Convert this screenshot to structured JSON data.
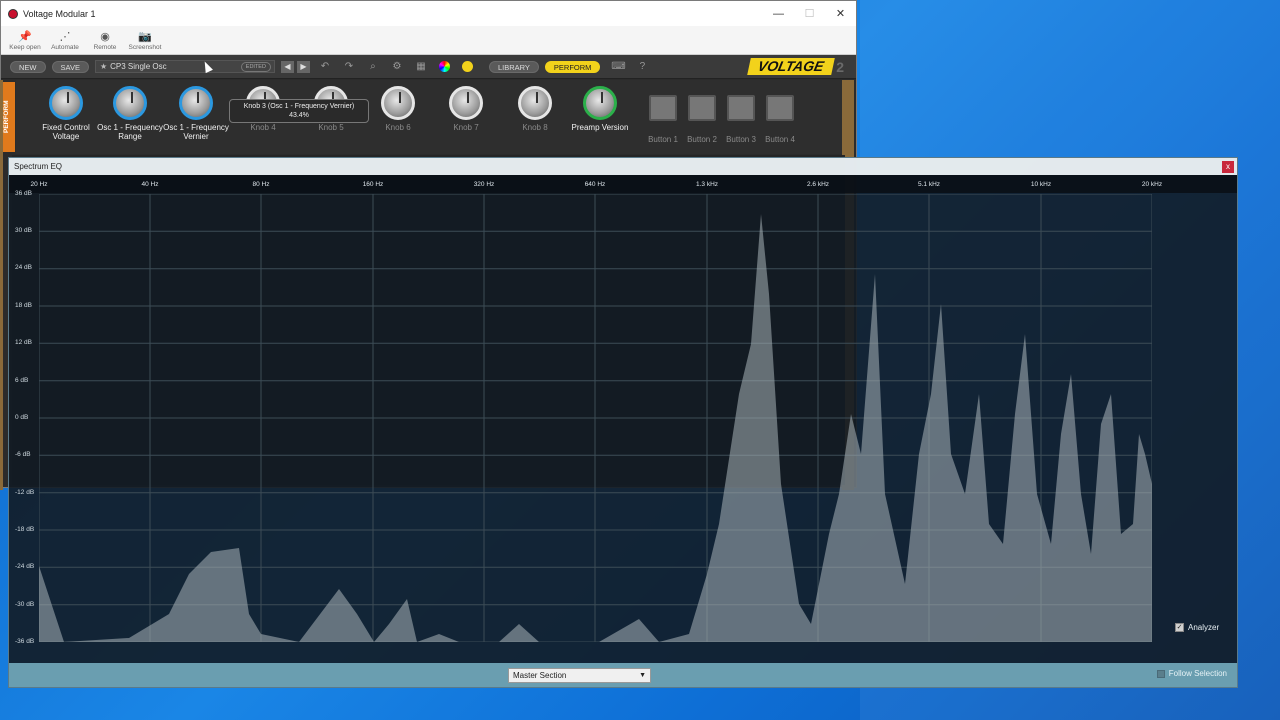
{
  "voltage_window": {
    "title": "Voltage Modular 1",
    "toolbar": [
      {
        "label": "Keep open",
        "icon": "pin-icon"
      },
      {
        "label": "Automate",
        "icon": "automate-icon"
      },
      {
        "label": "Remote",
        "icon": "remote-icon"
      },
      {
        "label": "Screenshot",
        "icon": "camera-icon"
      }
    ],
    "header": {
      "new_label": "NEW",
      "save_label": "SAVE",
      "preset_name": "CP3 Single Osc",
      "edited_label": "EDITED",
      "library_label": "LIBRARY",
      "perform_label": "PERFORM",
      "logo": "VOLTAGE",
      "logo_number": "2"
    },
    "perform_tab": "PERFORM",
    "knobs": [
      {
        "label1": "Fixed Control",
        "label2": "Voltage"
      },
      {
        "label1": "Osc 1 - Frequency",
        "label2": "Range"
      },
      {
        "label1": "Osc 1 - Frequency",
        "label2": "Vernier"
      },
      {
        "label1": "Knob 4",
        "label2": ""
      },
      {
        "label1": "Knob 5",
        "label2": ""
      },
      {
        "label1": "Knob 6",
        "label2": ""
      },
      {
        "label1": "Knob 7",
        "label2": ""
      },
      {
        "label1": "Knob 8",
        "label2": ""
      },
      {
        "label1": "Preamp Version",
        "label2": ""
      }
    ],
    "buttons": [
      "Button 1",
      "Button 2",
      "Button 3",
      "Button 4"
    ],
    "tooltip": {
      "line1": "Knob 3 (Osc 1 - Frequency Vernier)",
      "line2": "43.4%"
    }
  },
  "eq_window": {
    "title": "Spectrum EQ",
    "close_label": "x",
    "freq_labels": [
      "20 Hz",
      "40 Hz",
      "80 Hz",
      "160 Hz",
      "320 Hz",
      "640 Hz",
      "1.3 kHz",
      "2.6 kHz",
      "5.1 kHz",
      "10 kHz",
      "20 kHz"
    ],
    "db_labels": [
      "36 dB",
      "30 dB",
      "24 dB",
      "18 dB",
      "12 dB",
      "6 dB",
      "0 dB",
      "-6 dB",
      "-12 dB",
      "-18 dB",
      "-24 dB",
      "-30 dB",
      "-36 dB"
    ],
    "analyzer_label": "Analyzer",
    "analyzer_checked": "✓",
    "section_select": "Master Section",
    "follow_label": "Follow Selection"
  }
}
